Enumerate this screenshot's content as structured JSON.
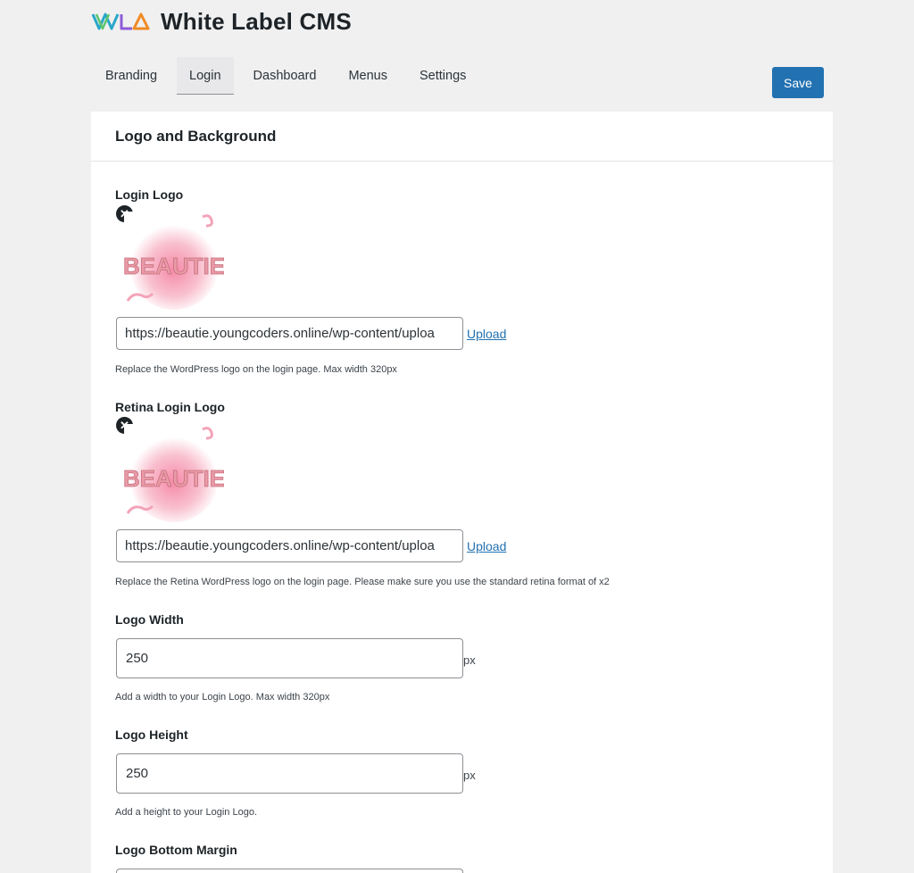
{
  "app": {
    "title": "White Label CMS"
  },
  "tabs": [
    {
      "label": "Branding"
    },
    {
      "label": "Login"
    },
    {
      "label": "Dashboard"
    },
    {
      "label": "Menus"
    },
    {
      "label": "Settings"
    }
  ],
  "active_tab": "Login",
  "save_label": "Save",
  "colors": {
    "accent": "#2271b1",
    "background": "#f0f0f1",
    "panel": "#ffffff"
  },
  "section": {
    "title": "Logo and Background"
  },
  "login_logo": {
    "label": "Login Logo",
    "url": "https://beautie.youngcoders.online/wp-content/uploa",
    "upload": "Upload",
    "help": "Replace the WordPress logo on the login page. Max width 320px",
    "image_text": "BEAUTIE"
  },
  "retina_logo": {
    "label": "Retina Login Logo",
    "url": "https://beautie.youngcoders.online/wp-content/uploa",
    "upload": "Upload",
    "help": "Replace the Retina WordPress logo on the login page. Please make sure you use the standard retina format of x2",
    "image_text": "BEAUTIE"
  },
  "logo_width": {
    "label": "Logo Width",
    "value": "250",
    "unit": "px",
    "help": "Add a width to your Login Logo. Max width 320px"
  },
  "logo_height": {
    "label": "Logo Height",
    "value": "250",
    "unit": "px",
    "help": "Add a height to your Login Logo."
  },
  "logo_bottom_margin": {
    "label": "Logo Bottom Margin"
  },
  "icons": {
    "remove": "close-circle-icon",
    "brand": "wlcms-logo-icon"
  }
}
